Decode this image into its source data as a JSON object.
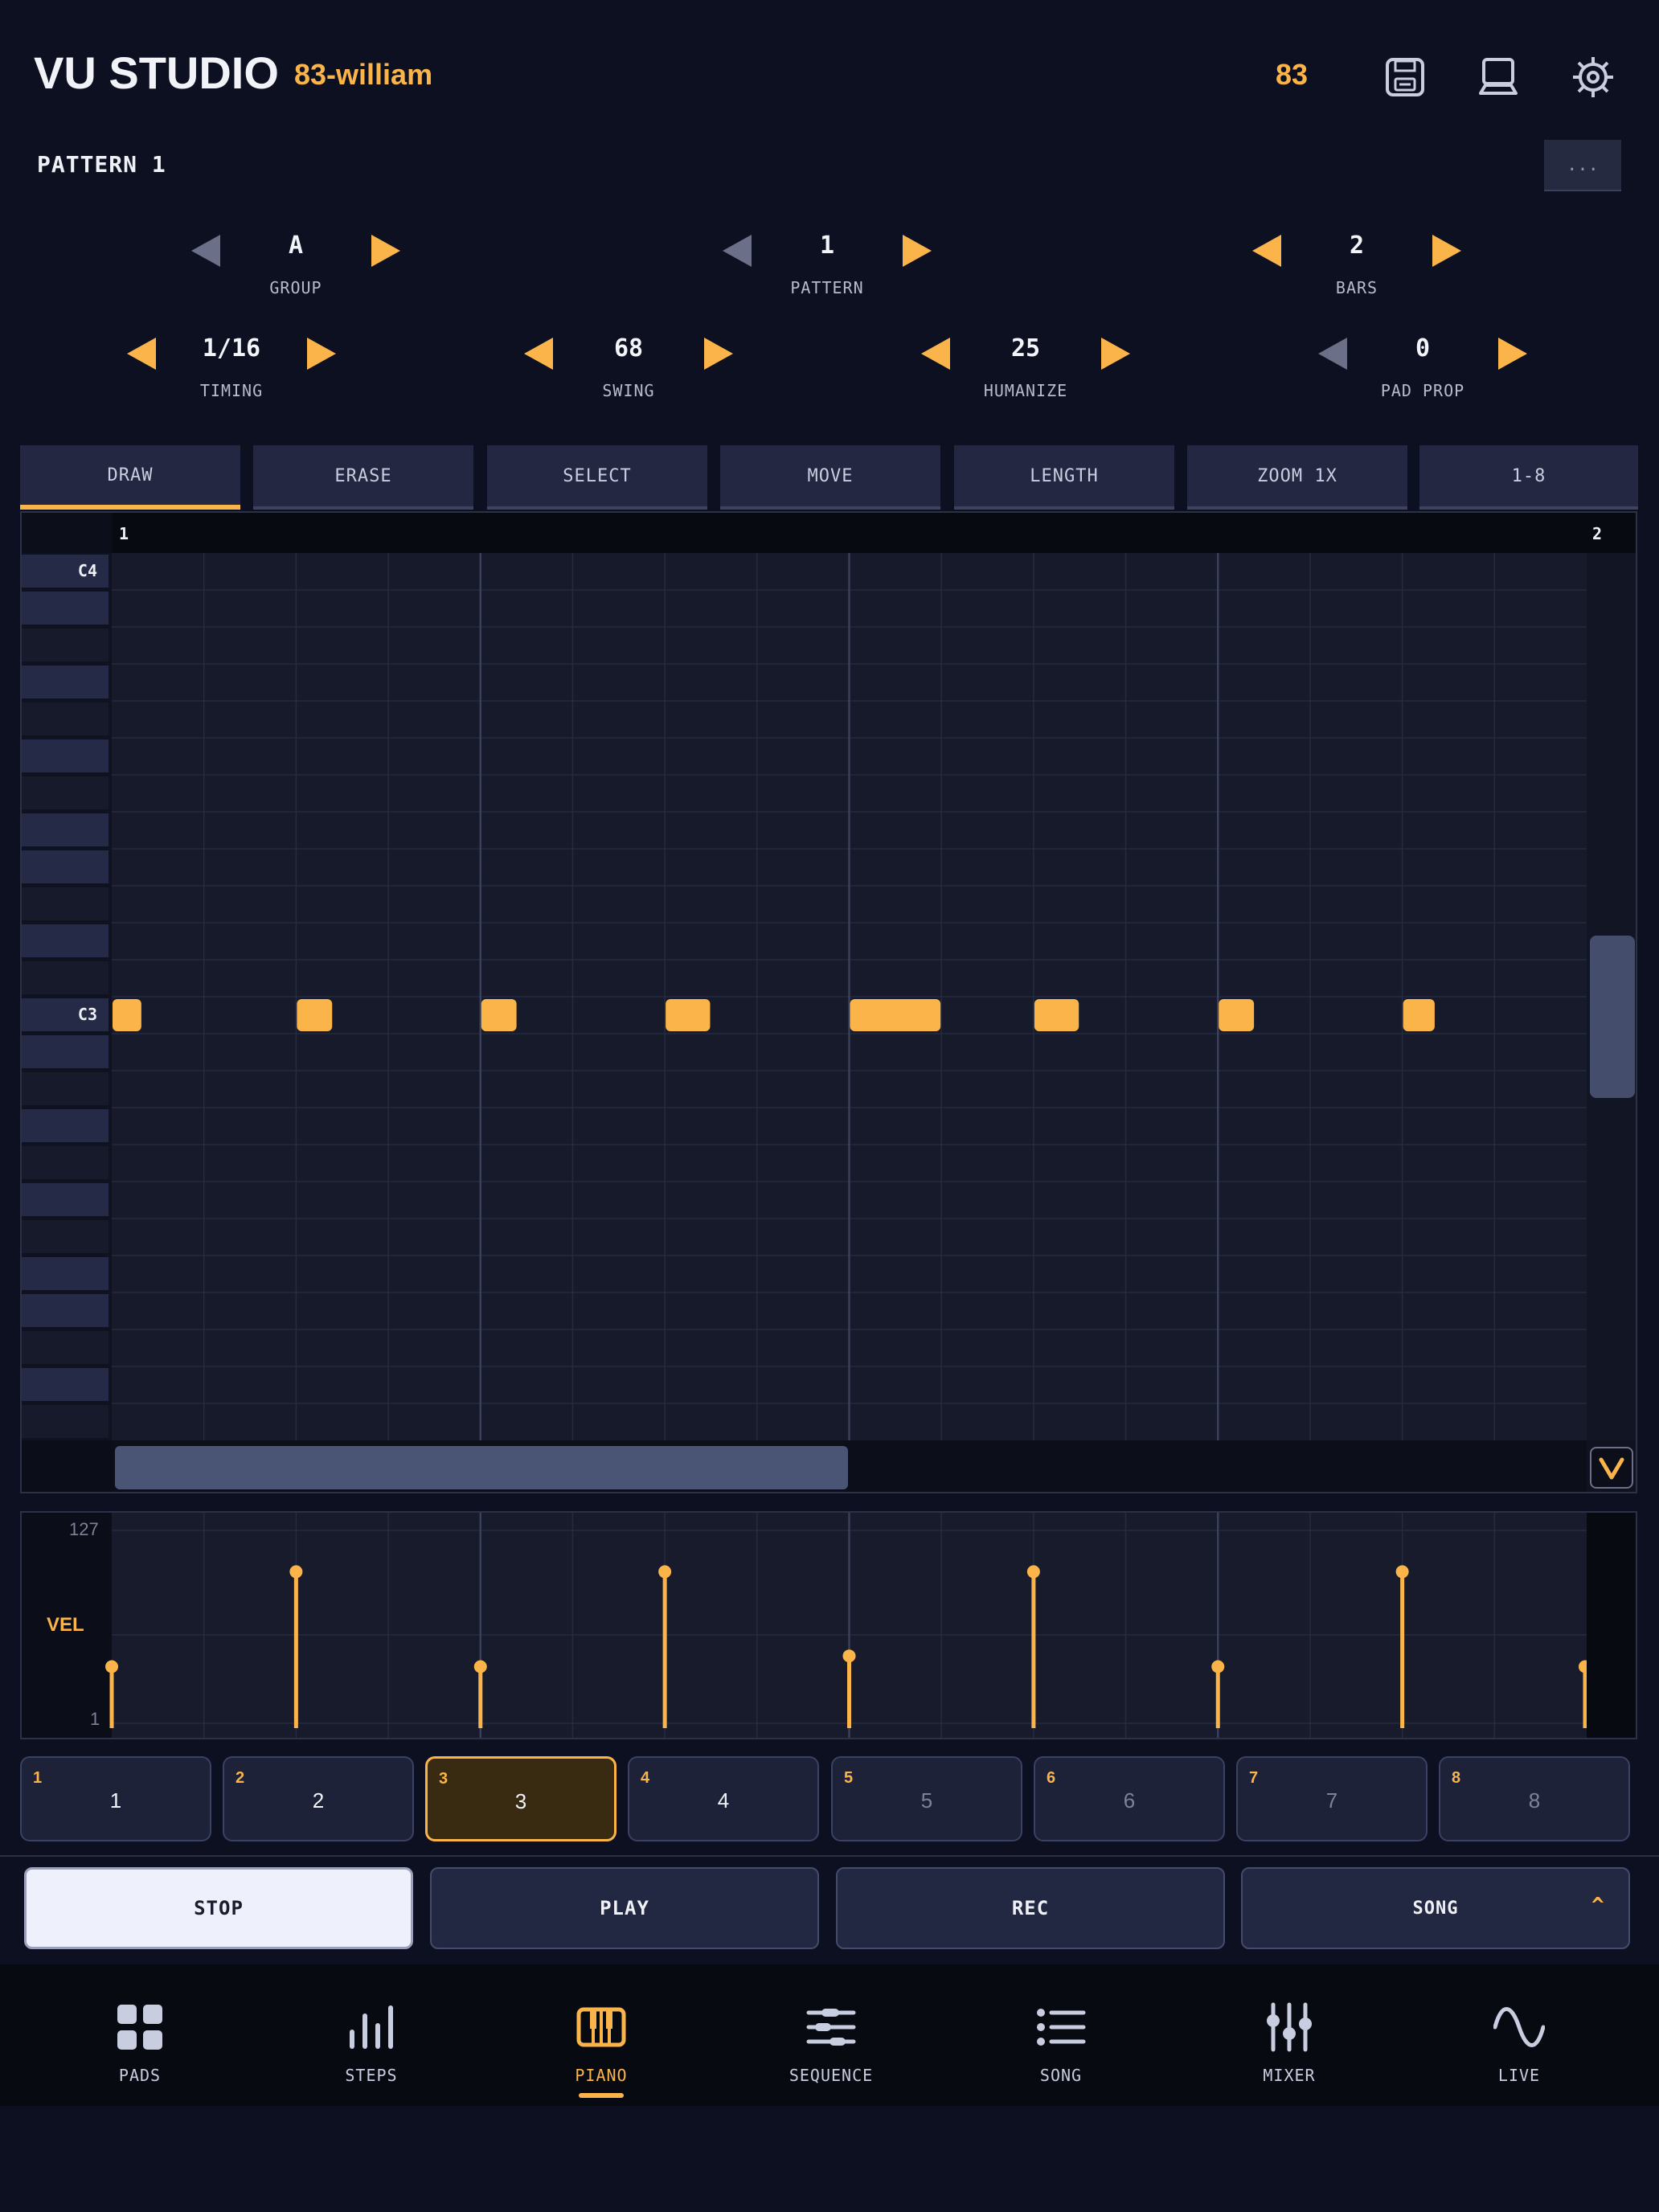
{
  "header": {
    "app_title": "VU STUDIO",
    "project_name": "83-william",
    "bpm": "83",
    "icons": [
      "save-icon",
      "computer-icon",
      "gear-icon"
    ]
  },
  "pattern": {
    "title": "PATTERN 1",
    "more_label": "..."
  },
  "steppers": {
    "group": {
      "value": "A",
      "label": "GROUP"
    },
    "pattern": {
      "value": "1",
      "label": "PATTERN"
    },
    "bars": {
      "value": "2",
      "label": "BARS"
    },
    "timing": {
      "value": "1/16",
      "label": "TIMING"
    },
    "swing": {
      "value": "68",
      "label": "SWING"
    },
    "humanize": {
      "value": "25",
      "label": "HUMANIZE"
    },
    "pad_prop": {
      "value": "0",
      "label": "PAD PROP"
    }
  },
  "tools": [
    {
      "label": "DRAW",
      "active": true
    },
    {
      "label": "ERASE"
    },
    {
      "label": "SELECT"
    },
    {
      "label": "MOVE"
    },
    {
      "label": "LENGTH"
    },
    {
      "label": "ZOOM 1X"
    },
    {
      "label": "1-8"
    }
  ],
  "piano_roll": {
    "ruler": [
      "1",
      "2"
    ],
    "key_labels": {
      "c4": "C4",
      "c3": "C3"
    },
    "rows_visible": 24,
    "steps_visible": 16,
    "notes": [
      {
        "pitch": "C3",
        "start_step": 0,
        "length_steps": 0.33
      },
      {
        "pitch": "C3",
        "start_step": 2,
        "length_steps": 0.4
      },
      {
        "pitch": "C3",
        "start_step": 4,
        "length_steps": 0.4
      },
      {
        "pitch": "C3",
        "start_step": 6,
        "length_steps": 0.5
      },
      {
        "pitch": "C3",
        "start_step": 8,
        "length_steps": 1.0
      },
      {
        "pitch": "C3",
        "start_step": 10,
        "length_steps": 0.5
      },
      {
        "pitch": "C3",
        "start_step": 12,
        "length_steps": 0.4
      },
      {
        "pitch": "C3",
        "start_step": 14,
        "length_steps": 0.36
      }
    ]
  },
  "velocity": {
    "label": "VEL",
    "max_label": "127",
    "min_label": "1",
    "values": [
      {
        "step": 0,
        "velocity": 38
      },
      {
        "step": 2,
        "velocity": 100
      },
      {
        "step": 4,
        "velocity": 38
      },
      {
        "step": 6,
        "velocity": 100
      },
      {
        "step": 8,
        "velocity": 45
      },
      {
        "step": 10,
        "velocity": 100
      },
      {
        "step": 12,
        "velocity": 38
      },
      {
        "step": 14,
        "velocity": 100
      },
      {
        "step": 16,
        "velocity": 38
      }
    ]
  },
  "pads": [
    {
      "num": "1",
      "label": "1"
    },
    {
      "num": "2",
      "label": "2"
    },
    {
      "num": "3",
      "label": "3",
      "active": true
    },
    {
      "num": "4",
      "label": "4"
    },
    {
      "num": "5",
      "label": "5",
      "dim": true
    },
    {
      "num": "6",
      "label": "6",
      "dim": true
    },
    {
      "num": "7",
      "label": "7",
      "dim": true
    },
    {
      "num": "8",
      "label": "8",
      "dim": true
    }
  ],
  "transport": {
    "stop": "STOP",
    "play": "PLAY",
    "rec": "REC",
    "song": "SONG",
    "song_caret": "^"
  },
  "nav": [
    {
      "label": "PADS",
      "icon": "grid-icon"
    },
    {
      "label": "STEPS",
      "icon": "bars-icon"
    },
    {
      "label": "PIANO",
      "icon": "piano-icon",
      "active": true
    },
    {
      "label": "SEQUENCE",
      "icon": "sequence-icon"
    },
    {
      "label": "SONG",
      "icon": "list-icon"
    },
    {
      "label": "MIXER",
      "icon": "mixer-icon"
    },
    {
      "label": "LIVE",
      "icon": "wave-icon"
    }
  ],
  "colors": {
    "accent": "#fbb449",
    "background": "#0d1020",
    "panel": "#232741"
  }
}
